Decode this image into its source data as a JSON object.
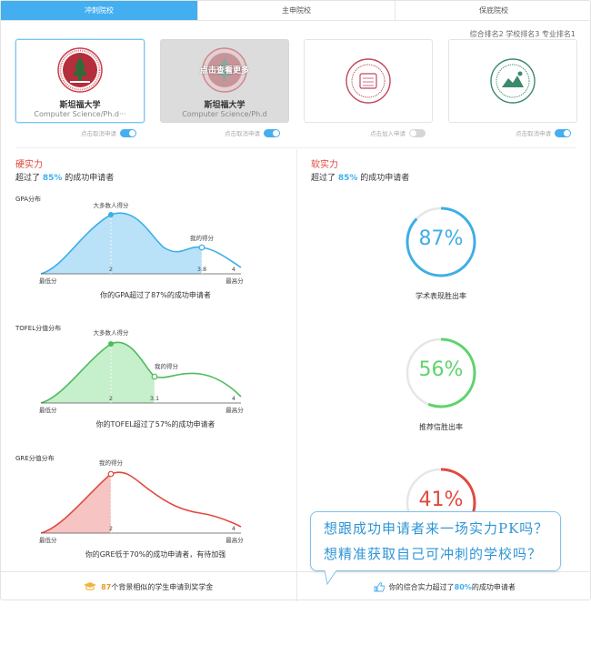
{
  "tabs": [
    {
      "label": "冲刺院校",
      "active": true
    },
    {
      "label": "主申院校",
      "active": false
    },
    {
      "label": "保底院校",
      "active": false
    }
  ],
  "ranking_text": "综合排名2 学校排名3 专业排名1",
  "schools": [
    {
      "name": "斯坦福大学",
      "program": "Computer Science/Ph.d···",
      "toggle_label": "点击取消申请",
      "selected": true
    },
    {
      "name": "斯坦福大学",
      "program": "Computer Science/Ph.d",
      "mask_label": "点击查看更多",
      "toggle_label": "点击取消申请"
    },
    {
      "toggle_label": "点击加入申请"
    },
    {
      "toggle_label": "点击取消申请"
    }
  ],
  "hard": {
    "title": "硬实力",
    "sub_prefix": "超过了 ",
    "sub_value": "85%",
    "sub_suffix": " 的成功申请者",
    "charts": [
      {
        "title": "GPA分布",
        "peak_label": "大多数人得分",
        "me_label": "我的得分",
        "min_label": "最低分",
        "max_label": "最高分",
        "peak_value": "2",
        "me_value": "3.8",
        "max_value": "4",
        "caption": "你的GPA超过了87%的成功申请者",
        "color": "#3eaee6",
        "fill": "#b9e1f8",
        "percent": 87
      },
      {
        "title": "TOFEL分值分布",
        "peak_label": "大多数人得分",
        "me_label": "我的得分",
        "min_label": "最低分",
        "max_label": "最高分",
        "peak_value": "2",
        "me_value": "3.1",
        "max_value": "4",
        "caption": "你的TOFEL超过了57%的成功申请者",
        "color": "#4dbb5b",
        "fill": "#c6efcb",
        "percent": 57
      },
      {
        "title": "GRE分值分布",
        "me_label": "我的得分",
        "min_label": "最低分",
        "max_label": "最高分",
        "peak_value": "2",
        "max_value": "4",
        "caption": "你的GRE低于70%的成功申请者，有待加强",
        "color": "#e04a3f",
        "fill": "#f6c4c2",
        "percent": 30
      }
    ]
  },
  "soft": {
    "title": "软实力",
    "sub_prefix": "超过了 ",
    "sub_value": "85%",
    "sub_suffix": " 的成功申请者",
    "rings": [
      {
        "value": 87,
        "text": "87%",
        "label": "学术表现胜出率",
        "color": "#3eaee6"
      },
      {
        "value": 56,
        "text": "56%",
        "label": "推荐信胜出率",
        "color": "#5fd36c"
      },
      {
        "value": 41,
        "text": "41%",
        "label": "",
        "color": "#e04a3f"
      }
    ]
  },
  "footer": {
    "left_num": "87",
    "left_text": "个背景相似的学生申请到奖学金",
    "right_prefix": "你的综合实力超过了",
    "right_value": "80%",
    "right_suffix": "的成功申请者"
  },
  "bubble": {
    "line1": "想跟成功申请者来一场实力PK吗？",
    "line2": "想精准获取自己可冲刺的学校吗？"
  }
}
